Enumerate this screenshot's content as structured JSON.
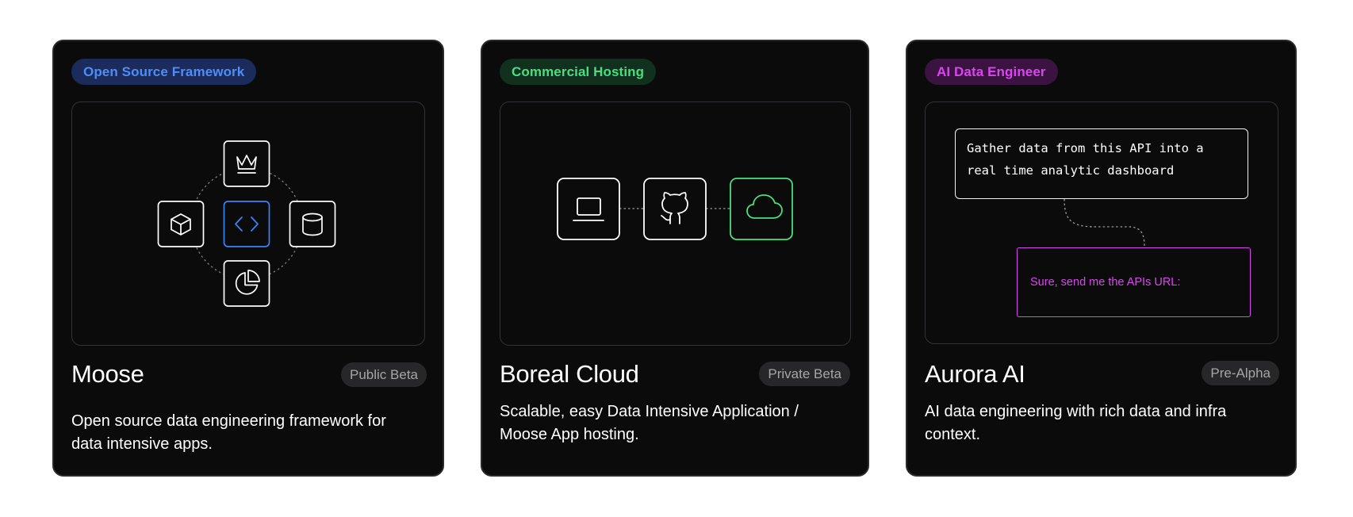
{
  "colors": {
    "card_background": "#0b0b0c",
    "page_background": "#ffffff",
    "blue_accent": "#3b82f6",
    "green_accent": "#4ade80",
    "magenta_accent": "#d946ef"
  },
  "cards": [
    {
      "badge": "Open Source Framework",
      "title": "Moose",
      "status": "Public Beta",
      "description_lines": [
        "Open source data engineering framework for",
        "data intensive apps."
      ],
      "icons": [
        "crown-icon",
        "cube-icon",
        "code-icon",
        "database-icon",
        "pie-chart-icon"
      ]
    },
    {
      "badge": "Commercial Hosting",
      "title": "Boreal Cloud",
      "status": "Private Beta",
      "description_lines": [
        "Scalable, easy Data Intensive Application /",
        "Moose App hosting."
      ],
      "icons": [
        "laptop-icon",
        "github-icon",
        "cloud-icon"
      ]
    },
    {
      "badge": "AI Data Engineer",
      "title": "Aurora AI",
      "status": "Pre-Alpha",
      "description_lines": [
        "AI data engineering with rich data and infra",
        "context."
      ],
      "prompt_lines": [
        "Gather data from this API into a",
        "real time analytic dashboard"
      ],
      "reply": "Sure, send me the APIs URL:"
    }
  ]
}
